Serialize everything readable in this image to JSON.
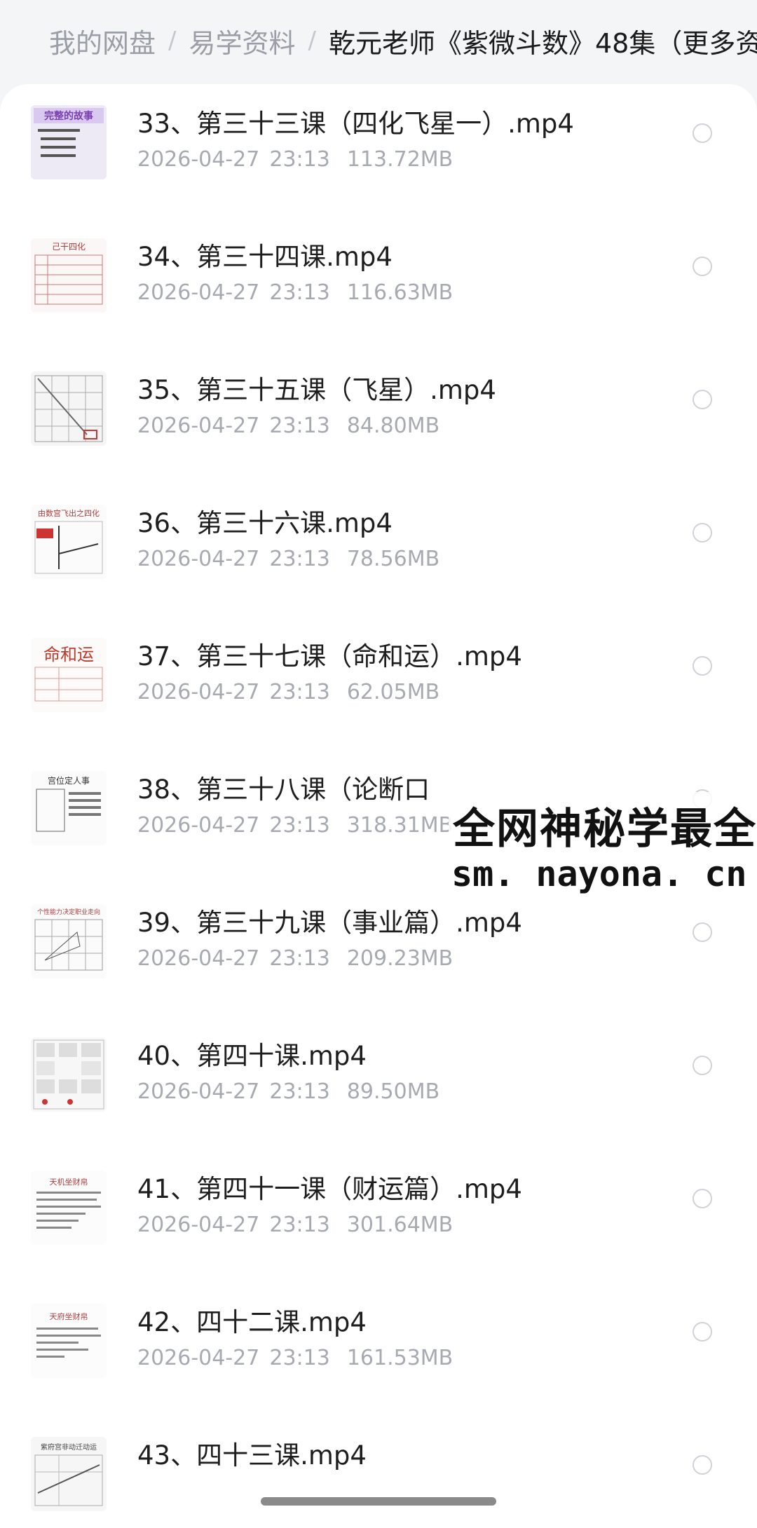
{
  "breadcrumb": {
    "items": [
      "我的网盘",
      "易学资料"
    ],
    "current": "乾元老师《紫微斗数》48集（更多资"
  },
  "files": [
    {
      "name": "33、第三十三课（四化飞星一）.mp4",
      "date": "2026-04-27",
      "time": "23:13",
      "size": "113.72MB",
      "thumb_text": "完整的故事"
    },
    {
      "name": "34、第三十四课.mp4",
      "date": "2026-04-27",
      "time": "23:13",
      "size": "116.63MB",
      "thumb_text": "己干四化"
    },
    {
      "name": "35、第三十五课（飞星）.mp4",
      "date": "2026-04-27",
      "time": "23:13",
      "size": "84.80MB",
      "thumb_text": ""
    },
    {
      "name": "36、第三十六课.mp4",
      "date": "2026-04-27",
      "time": "23:13",
      "size": "78.56MB",
      "thumb_text": "由数宫飞出之四化"
    },
    {
      "name": "37、第三十七课（命和运）.mp4",
      "date": "2026-04-27",
      "time": "23:13",
      "size": "62.05MB",
      "thumb_text": "命和运"
    },
    {
      "name": "38、第三十八课（论断口",
      "date": "2026-04-27",
      "time": "23:13",
      "size": "318.31MB",
      "thumb_text": "宫位定人事"
    },
    {
      "name": "39、第三十九课（事业篇）.mp4",
      "date": "2026-04-27",
      "time": "23:13",
      "size": "209.23MB",
      "thumb_text": "个性能力决定职业走向"
    },
    {
      "name": "40、第四十课.mp4",
      "date": "2026-04-27",
      "time": "23:13",
      "size": "89.50MB",
      "thumb_text": ""
    },
    {
      "name": "41、第四十一课（财运篇）.mp4",
      "date": "2026-04-27",
      "time": "23:13",
      "size": "301.64MB",
      "thumb_text": "天机坐财帛"
    },
    {
      "name": "42、四十二课.mp4",
      "date": "2026-04-27",
      "time": "23:13",
      "size": "161.53MB",
      "thumb_text": "天府坐财帛"
    },
    {
      "name": "43、四十三课.mp4",
      "date": "",
      "time": "",
      "size": "",
      "thumb_text": "紫府宫非动迁动运"
    }
  ],
  "watermark": {
    "line1": "全网神秘学最全",
    "line2": "sm. nayona. cn"
  },
  "colors": {
    "accent_red": "#c0392b",
    "meta_gray": "#a7aab0",
    "title_black": "#1e1e1e"
  }
}
